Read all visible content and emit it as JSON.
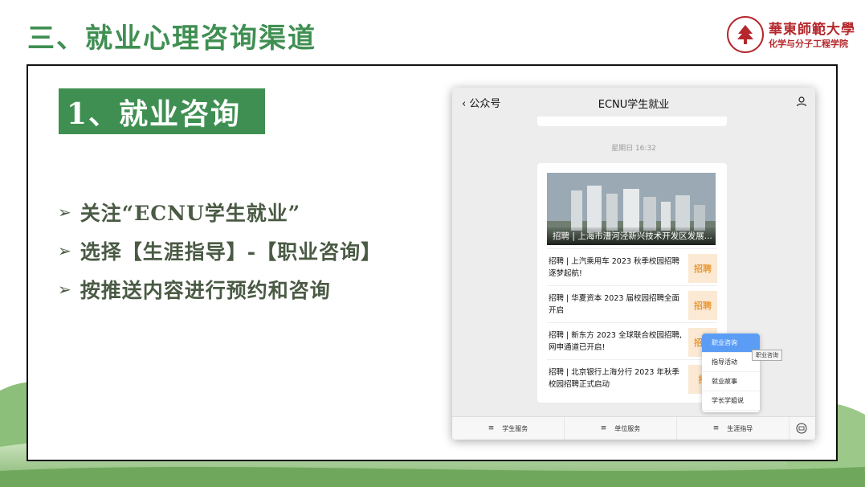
{
  "slide": {
    "title": "三、就业心理咨询渠道",
    "logo_university": "華東師範大學",
    "logo_school": "化学与分子工程学院",
    "section_label": "1、就业咨询",
    "bullets": [
      "关注“ECNU学生就业”",
      "选择【生涯指导】-【职业咨询】",
      "按推送内容进行预约和咨询"
    ],
    "bullet_marker": "➢"
  },
  "phone": {
    "back_label": "公众号",
    "back_icon": "chevron-left-icon",
    "account_name": "ECNU学生就业",
    "timestamp": "星期日 16:32",
    "hero_caption": "招聘 | 上海市漕河泾新兴技术开发区发展...",
    "articles": [
      {
        "title": "招聘 | 上汽乘用车 2023 秋季校园招聘逐梦起航!",
        "thumb": "招聘"
      },
      {
        "title": "招聘 | 华夏资本 2023 届校园招聘全面开启",
        "thumb": "招聘"
      },
      {
        "title": "招聘 | 新东方 2023 全球联合校园招聘,网申通道已开启!",
        "thumb": "招聘"
      },
      {
        "title": "招聘 | 北京银行上海分行 2023 年秋季校园招聘正式启动",
        "thumb": "招"
      }
    ],
    "menu": [
      "学生服务",
      "单位服务",
      "生涯指导"
    ],
    "menu_icon": "≡",
    "popup_items": [
      "职业咨询",
      "指导活动",
      "就业故事",
      "学长学姐说"
    ],
    "popup_active": "职业咨询",
    "tooltip": "职业咨询"
  },
  "colors": {
    "accent_green": "#3f8f52",
    "bullet_text": "#4a5a44",
    "brand_red": "#b5272c",
    "popup_active": "#5b9df5"
  }
}
